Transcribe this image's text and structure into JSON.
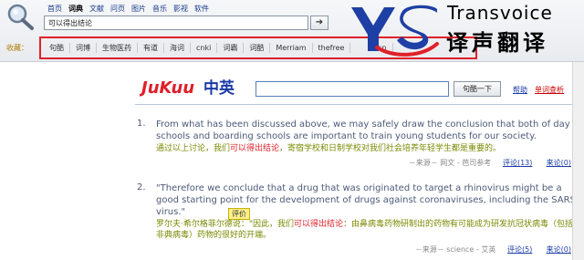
{
  "nav": [
    "首页",
    "词典",
    "文献",
    "问页",
    "图片",
    "音乐",
    "影视",
    "软件"
  ],
  "nav_active": 1,
  "search": {
    "value": "可以得出结论",
    "go": "➔"
  },
  "favorites": {
    "label": "收藏：",
    "items": [
      "句酷",
      "词博",
      "生物医药",
      "有道",
      "海词",
      "cnki",
      "词霸",
      "词酷",
      "Merriam",
      "thefree",
      "",
      "refsn"
    ]
  },
  "brand": {
    "name_en": "Transvoice",
    "name_cn": "译声翻译"
  },
  "jukuu": {
    "logo_en": "JuKuu",
    "logo_cn": "中英",
    "search_button": "句酷一下",
    "help": "帮助",
    "unknown_words": "单词查析"
  },
  "results": [
    {
      "num": "1.",
      "en": "From what has been discussed above, we may safely draw the conclusion that both of day schools and boarding schools are important to train young students for our society.",
      "cn_before": "通过以上讨论，我们",
      "cn_highlight": "可以得出结论",
      "cn_after": "，寄宿学校和日制学校对我们社会培养年轻学生都是重要的。",
      "source": "－来源－ 网文 - 芭司参考",
      "comment": "评论(13)",
      "back": "来论(0)"
    },
    {
      "num": "2.",
      "en": "\"Therefore we conclude that a drug that was originated to target a rhinovirus might be a good starting point for the development of drugs against coronaviruses, including the SARS virus.\"",
      "tip": "评价",
      "cn_before": "罗尔夫·希尔格菲尔德说：\"因此，我们",
      "cn_highlight": "可以得出结论",
      "cn_after": "：由鼻病毒药物研制出的药物有可能成为研发抗冠状病毒（包括非典病毒）药物的很好的开端。",
      "source": "－来源－ science - 艾英",
      "comment": "评论(5)",
      "back": "来论(0)"
    }
  ],
  "colors": {
    "highlight": "#e0202a",
    "translation": "#7a8a00",
    "english": "#4d5a78",
    "brand_blue": "#1e3fa5",
    "brand_red": "#e0202a"
  }
}
